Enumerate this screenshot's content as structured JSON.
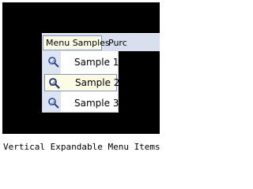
{
  "menubar": {
    "items": [
      {
        "label": "Menu Samples"
      },
      {
        "label": "Purc"
      }
    ]
  },
  "submenu": {
    "items": [
      {
        "label": "Sample 1",
        "icon": "magnifier-pen-icon"
      },
      {
        "label": "Sample 2",
        "icon": "magnifier-pen-icon"
      },
      {
        "label": "Sample 3",
        "icon": "magnifier-pen-icon"
      }
    ]
  },
  "caption": "Vertical Expandable Menu Items ...",
  "colors": {
    "panel": "#000000",
    "menubar": "#d9dfee",
    "highlight": "#fbfbe6",
    "highlight_border": "#8a97b8",
    "gutter": "#dde4f1"
  }
}
